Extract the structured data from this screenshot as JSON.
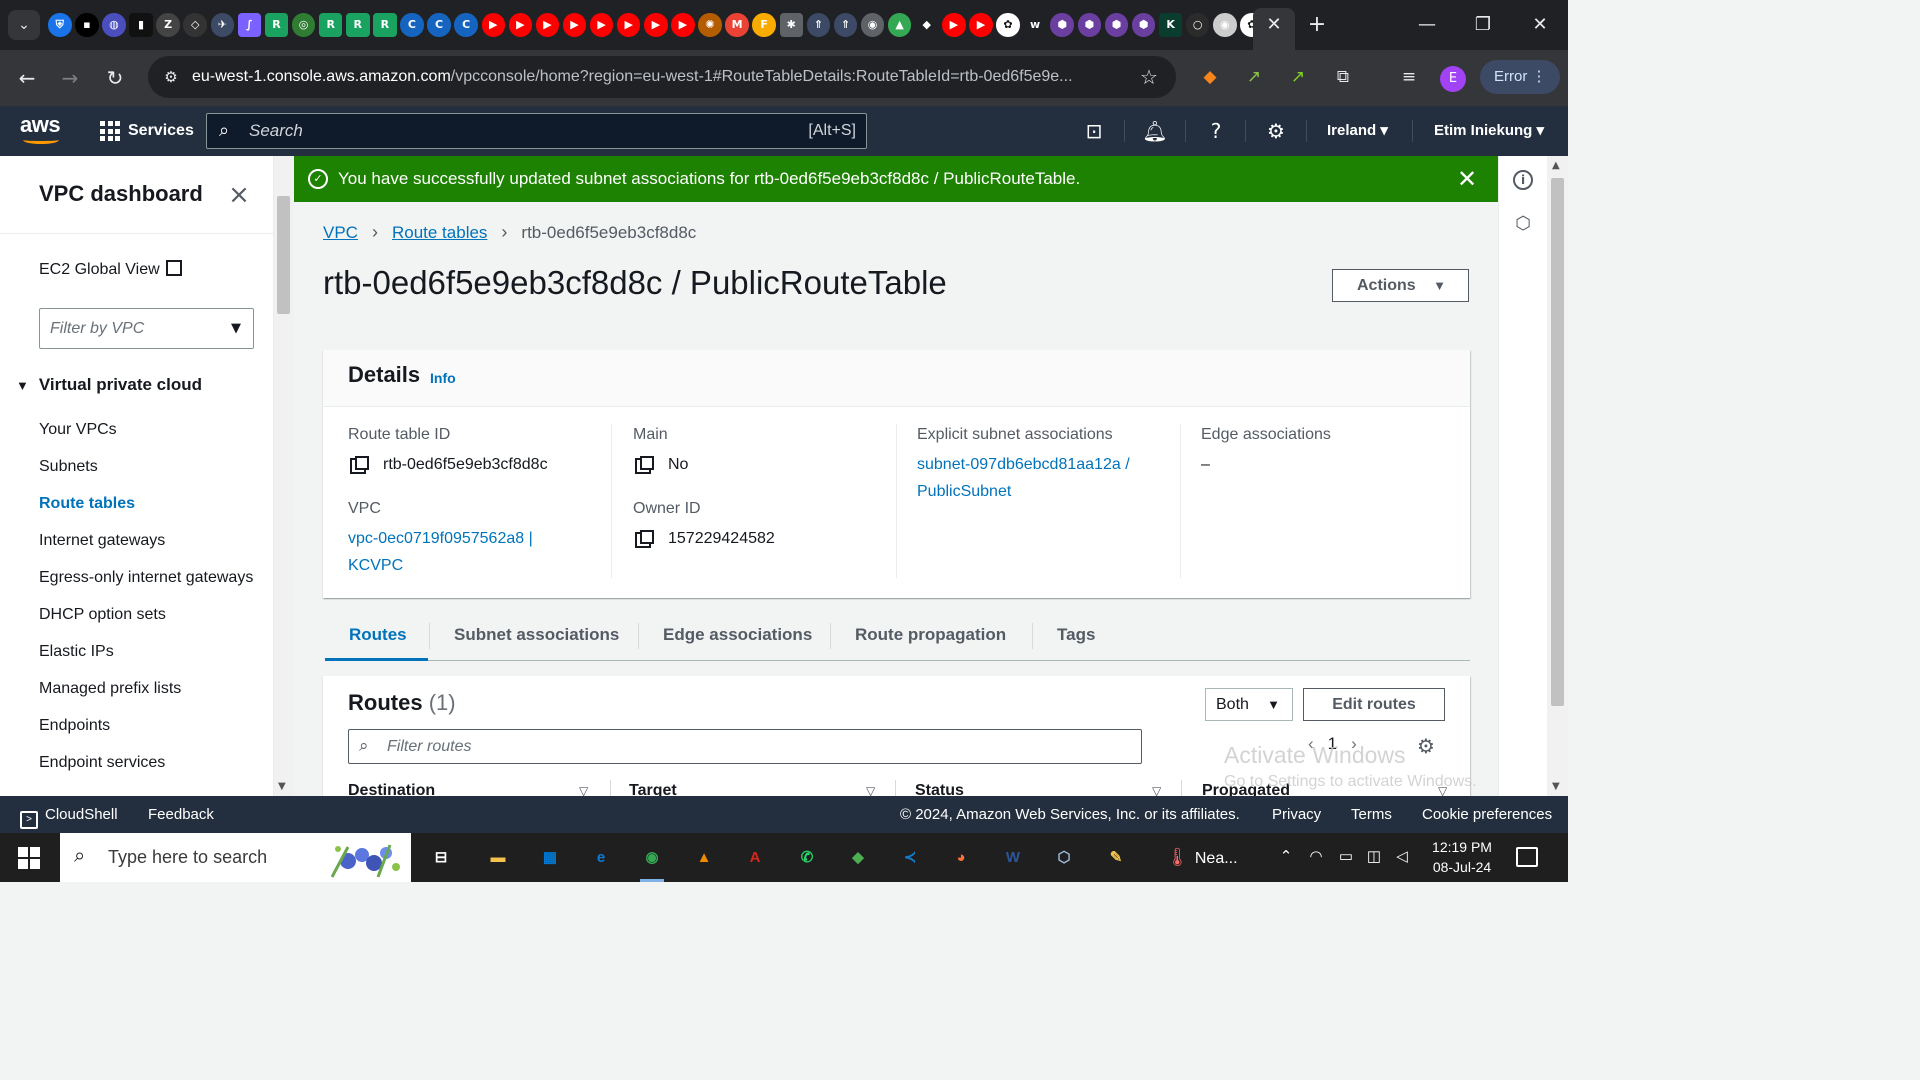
{
  "browser": {
    "tab_favicons": [
      {
        "icon": "shield-icon",
        "color": "#1a73e8"
      },
      {
        "icon": "terminal-icon",
        "color": "#000000"
      },
      {
        "icon": "globe-icon",
        "color": "#4a4fbd"
      },
      {
        "icon": "dark-square-icon",
        "color": "#111111"
      },
      {
        "icon": "zigzag-icon",
        "color": "#444444"
      },
      {
        "icon": "diamond-icon",
        "color": "#333333"
      },
      {
        "icon": "plane-icon",
        "color": "#3c4a66"
      },
      {
        "icon": "feather-icon",
        "color": "#7b61ff"
      },
      {
        "icon": "green-r-icon",
        "color": "#1aa260"
      },
      {
        "icon": "green-circle-icon",
        "color": "#2e7d32"
      },
      {
        "icon": "green-r-icon",
        "color": "#1aa260"
      },
      {
        "icon": "green-r-icon",
        "color": "#1aa260"
      },
      {
        "icon": "green-r-icon",
        "color": "#1aa260"
      },
      {
        "icon": "c-icon",
        "color": "#1565c0"
      },
      {
        "icon": "c-icon",
        "color": "#1565c0"
      },
      {
        "icon": "c-icon",
        "color": "#1565c0"
      },
      {
        "icon": "youtube-icon",
        "color": "#ff0000"
      },
      {
        "icon": "youtube-icon",
        "color": "#ff0000"
      },
      {
        "icon": "youtube-icon",
        "color": "#ff0000"
      },
      {
        "icon": "youtube-icon",
        "color": "#ff0000"
      },
      {
        "icon": "youtube-icon",
        "color": "#ff0000"
      },
      {
        "icon": "youtube-icon",
        "color": "#ff0000"
      },
      {
        "icon": "youtube-icon",
        "color": "#ff0000"
      },
      {
        "icon": "youtube-icon",
        "color": "#ff0000"
      },
      {
        "icon": "sun-icon",
        "color": "#b35c00"
      },
      {
        "icon": "gmail-icon",
        "color": "#ea4335"
      },
      {
        "icon": "f-icon",
        "color": "#f9ab00"
      },
      {
        "icon": "gear-star-icon",
        "color": "#5f6368"
      },
      {
        "icon": "rocket-icon",
        "color": "#3c4a66"
      },
      {
        "icon": "rocket-icon",
        "color": "#3c4a66"
      },
      {
        "icon": "circle-icon",
        "color": "#5f6368"
      },
      {
        "icon": "drive-icon",
        "color": "#34a853"
      },
      {
        "icon": "cube-icon",
        "color": "#202124"
      },
      {
        "icon": "youtube-icon",
        "color": "#ff0000"
      },
      {
        "icon": "youtube-icon",
        "color": "#ff0000"
      },
      {
        "icon": "openai-icon",
        "color": "#ffffff"
      },
      {
        "icon": "w-icon",
        "color": "#202124"
      },
      {
        "icon": "purple-hex-icon",
        "color": "#6b3fa0"
      },
      {
        "icon": "purple-hex-icon",
        "color": "#6b3fa0"
      },
      {
        "icon": "purple-hex-icon",
        "color": "#6b3fa0"
      },
      {
        "icon": "purple-hex-icon",
        "color": "#6b3fa0"
      },
      {
        "icon": "k-icon",
        "color": "#0b3d2e"
      },
      {
        "icon": "ring-icon",
        "color": "#2b2b2b"
      },
      {
        "icon": "record-icon",
        "color": "#cccccc"
      },
      {
        "icon": "openai-icon",
        "color": "#ffffff"
      }
    ],
    "url_host": "eu-west-1.console.aws.amazon.com",
    "url_rest": "/vpcconsole/home?region=eu-west-1#RouteTableDetails:RouteTableId=rtb-0ed6f5e9e...",
    "profile_initial": "E",
    "error_label": "Error"
  },
  "aws_nav": {
    "logo": "aws",
    "services_label": "Services",
    "search_placeholder": "Search",
    "search_shortcut": "[Alt+S]",
    "region": "Ireland",
    "user": "Etim Iniekung"
  },
  "sidebar": {
    "title": "VPC dashboard",
    "ec2_global_view": "EC2 Global View",
    "filter_placeholder": "Filter by VPC",
    "group_label": "Virtual private cloud",
    "items": [
      {
        "label": "Your VPCs"
      },
      {
        "label": "Subnets"
      },
      {
        "label": "Route tables"
      },
      {
        "label": "Internet gateways"
      },
      {
        "label": "Egress-only internet gateways"
      },
      {
        "label": "DHCP option sets"
      },
      {
        "label": "Elastic IPs"
      },
      {
        "label": "Managed prefix lists"
      },
      {
        "label": "Endpoints"
      },
      {
        "label": "Endpoint services"
      }
    ],
    "active_item": "Route tables"
  },
  "flash": {
    "message": "You have successfully updated subnet associations for rtb-0ed6f5e9eb3cf8d8c / PublicRouteTable.",
    "color": "#1d8102"
  },
  "breadcrumb": {
    "items": [
      "VPC",
      "Route tables"
    ],
    "current": "rtb-0ed6f5e9eb3cf8d8c"
  },
  "page": {
    "title": "rtb-0ed6f5e9eb3cf8d8c / PublicRouteTable",
    "actions_label": "Actions"
  },
  "details": {
    "title": "Details",
    "info_link": "Info",
    "route_table_id_label": "Route table ID",
    "route_table_id": "rtb-0ed6f5e9eb3cf8d8c",
    "vpc_label": "VPC",
    "vpc_value_line1": "vpc-0ec0719f0957562a8 |",
    "vpc_value_line2": "KCVPC",
    "main_label": "Main",
    "main_value": "No",
    "owner_label": "Owner ID",
    "owner_value": "157229424582",
    "explicit_label": "Explicit subnet associations",
    "explicit_line1": "subnet-097db6ebcd81aa12a /",
    "explicit_line2": "PublicSubnet",
    "edge_label": "Edge associations",
    "edge_value": "–"
  },
  "tabs": [
    "Routes",
    "Subnet associations",
    "Edge associations",
    "Route propagation",
    "Tags"
  ],
  "active_tab": "Routes",
  "routes": {
    "title": "Routes",
    "count": "(1)",
    "both_label": "Both",
    "edit_label": "Edit routes",
    "filter_placeholder": "Filter routes",
    "page_number": "1",
    "columns": [
      "Destination",
      "Target",
      "Status",
      "Propagated"
    ]
  },
  "watermark": {
    "line1": "Activate Windows",
    "line2": "Go to Settings to activate Windows."
  },
  "footer": {
    "cloudshell": "CloudShell",
    "feedback": "Feedback",
    "copyright": "© 2024, Amazon Web Services, Inc. or its affiliates.",
    "privacy": "Privacy",
    "terms": "Terms",
    "cookies": "Cookie preferences"
  },
  "taskbar": {
    "search_placeholder": "Type here to search",
    "apps": [
      {
        "icon": "task-view-icon",
        "color": "#1f1f1f"
      },
      {
        "icon": "file-explorer-icon",
        "color": "#f2c14e"
      },
      {
        "icon": "store-icon",
        "color": "#0078d4"
      },
      {
        "icon": "edge-icon",
        "color": "#0f7bd6"
      },
      {
        "icon": "chrome-icon",
        "color": "#34a853"
      },
      {
        "icon": "vlc-icon",
        "color": "#f08a00"
      },
      {
        "icon": "acrobat-icon",
        "color": "#d7261e"
      },
      {
        "icon": "whatsapp-icon",
        "color": "#25d366"
      },
      {
        "icon": "app-diamond-icon",
        "color": "#4caf50"
      },
      {
        "icon": "vscode-icon",
        "color": "#0e7fcf"
      },
      {
        "icon": "firefox-icon",
        "color": "#ff7139"
      },
      {
        "icon": "word-icon",
        "color": "#2b579a"
      },
      {
        "icon": "cube-app-icon",
        "color": "#9bb7d4"
      },
      {
        "icon": "sticky-app-icon",
        "color": "#f2c14e"
      }
    ],
    "weather": "Nea...",
    "time": "12:19 PM",
    "date": "08-Jul-24"
  }
}
